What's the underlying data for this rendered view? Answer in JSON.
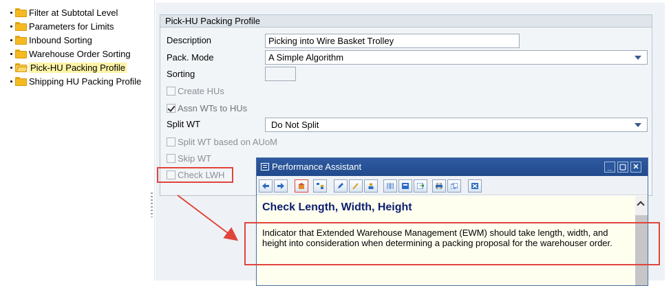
{
  "tree": {
    "items": [
      {
        "label": "Filter at Subtotal Level"
      },
      {
        "label": "Parameters for Limits"
      },
      {
        "label": "Inbound Sorting"
      },
      {
        "label": "Warehouse Order Sorting"
      },
      {
        "label": "Pick-HU Packing Profile",
        "selected": true
      },
      {
        "label": "Shipping HU Packing Profile"
      }
    ]
  },
  "panel": {
    "title": "Pick-HU Packing Profile",
    "description_label": "Description",
    "description_value": "Picking into Wire Basket Trolley",
    "pack_mode_label": "Pack. Mode",
    "pack_mode_value": "A Simple Algorithm",
    "sorting_label": "Sorting",
    "sorting_value": "",
    "create_hus_label": "Create HUs",
    "assn_wts_label": "Assn WTs to HUs",
    "split_wt_label": "Split WT",
    "split_wt_value": "Do Not Split",
    "split_auom_label": "Split WT based on AUoM",
    "skip_wt_label": "Skip WT",
    "check_lwh_label": "Check LWH"
  },
  "assistant": {
    "title": "Performance Assistant",
    "heading": "Check Length, Width, Height",
    "text": "Indicator that Extended Warehouse Management (EWM) should take length, width, and height into consideration when determining a packing proposal for the warehouser order."
  },
  "colors": {
    "annotation": "#e0443a",
    "title_bar": "#2f5aa0",
    "heading": "#0b1e6e"
  }
}
